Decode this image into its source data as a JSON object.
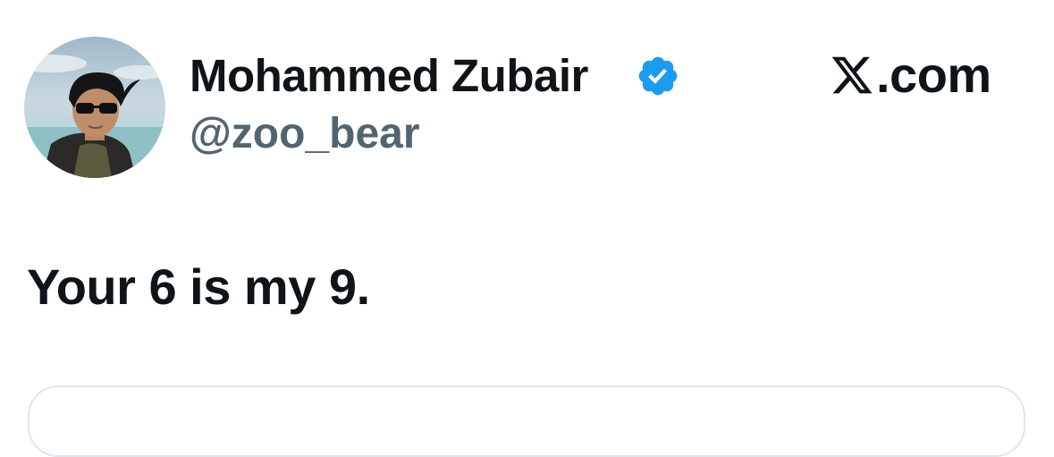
{
  "author": {
    "display_name": "Mohammed Zubair",
    "handle": "@zoo_bear",
    "verified": true,
    "verified_icon": "verified-badge-icon",
    "avatar": "profile-photo"
  },
  "brand": {
    "logo_icon": "x-logo-icon",
    "domain": ".com"
  },
  "tweet": {
    "text": "Your 6 is my 9."
  },
  "colors": {
    "text_primary": "#0f1419",
    "text_secondary": "#536471",
    "verified_blue": "#1d9bf0",
    "card_border": "#e1e6ea"
  }
}
